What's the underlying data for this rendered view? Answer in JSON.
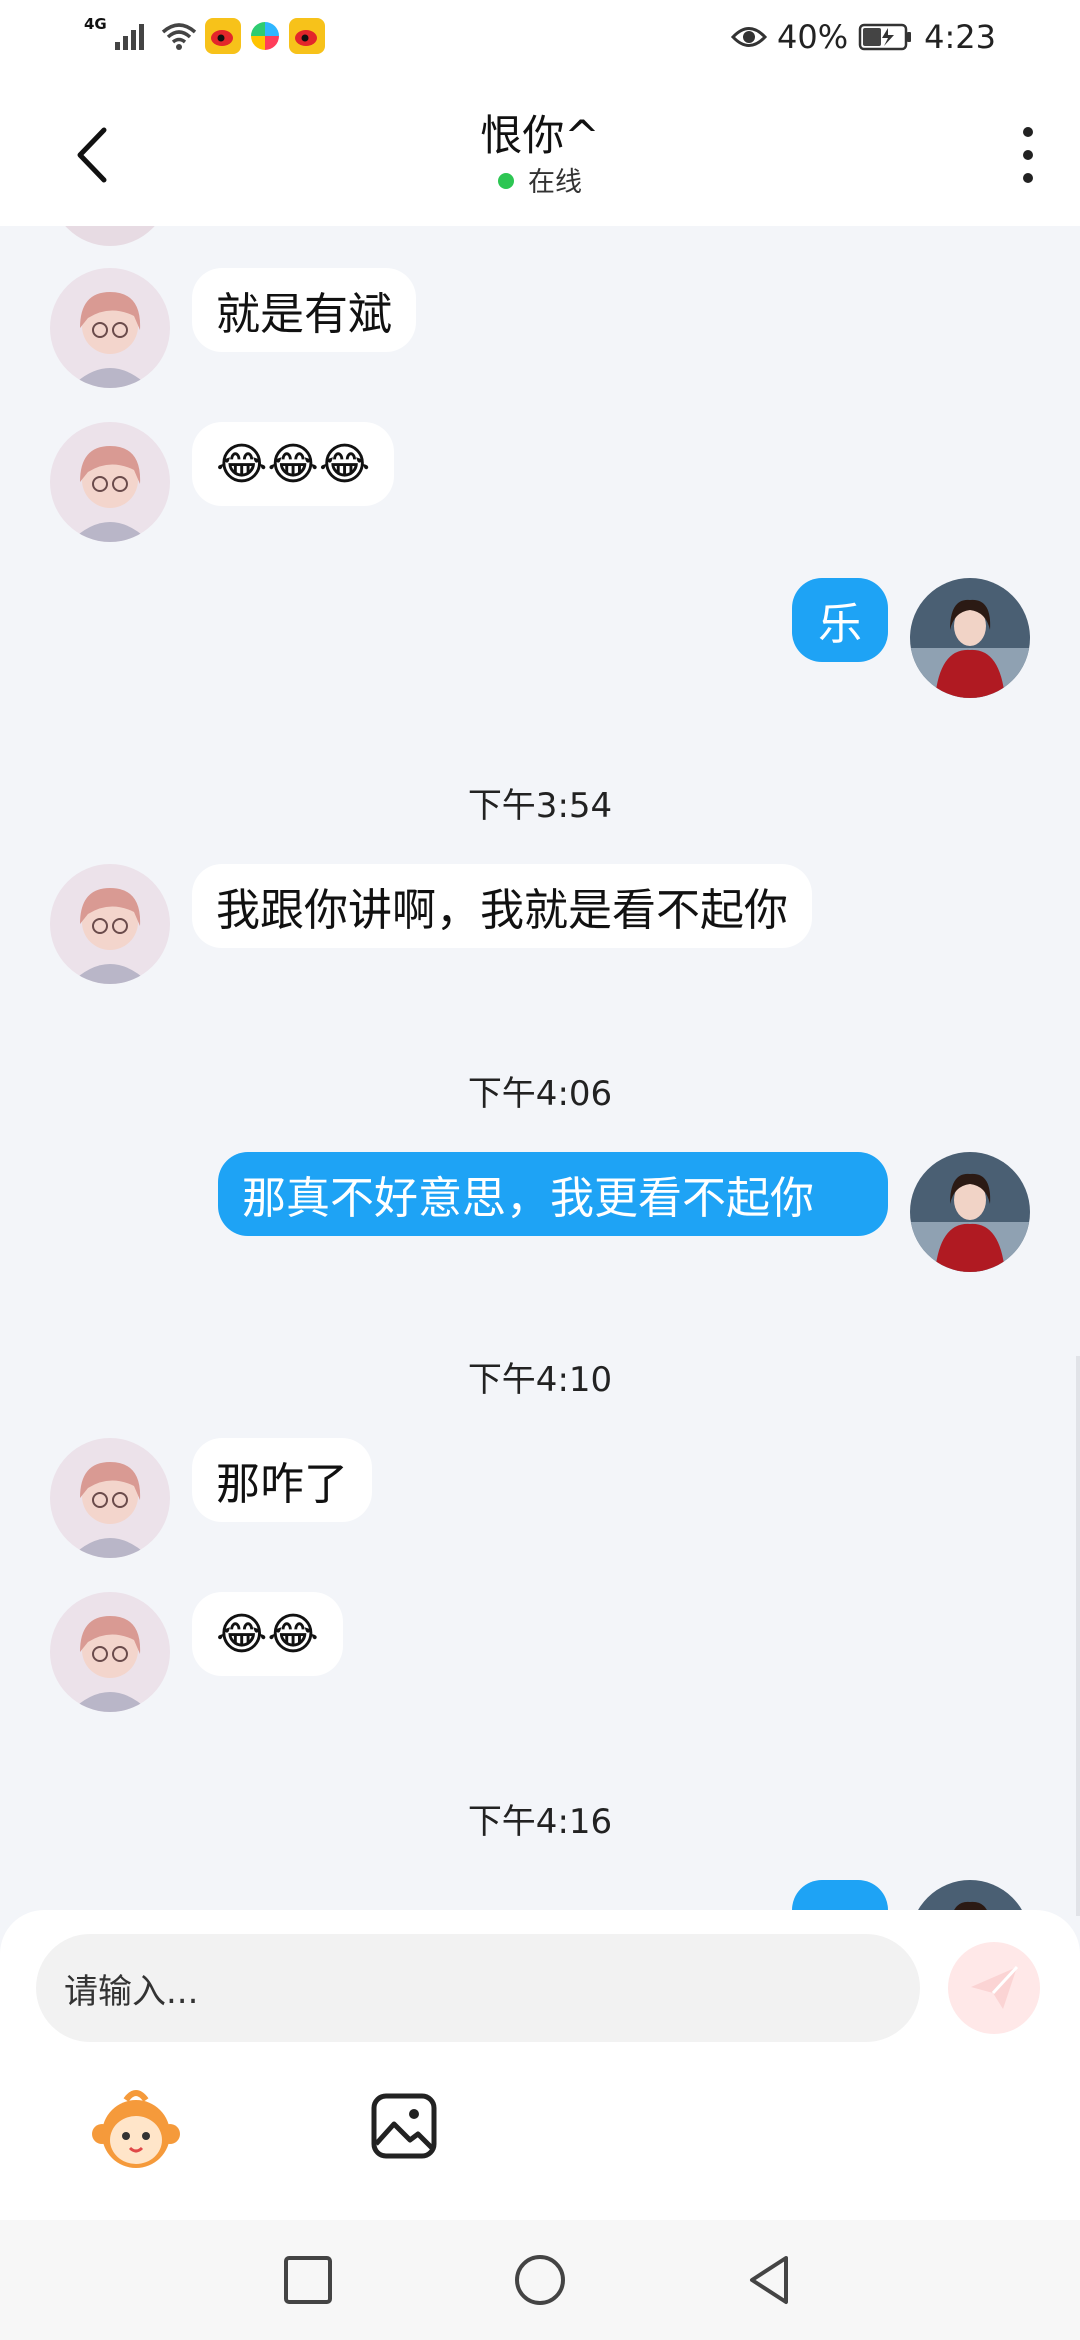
{
  "status_bar": {
    "network": "4G",
    "eye_icon": "eye-icon",
    "battery_percent": "40%",
    "time": "4:23"
  },
  "header": {
    "title": "恨你^",
    "status": "在线"
  },
  "messages": [
    {
      "side": "in",
      "text": "就是有斌"
    },
    {
      "side": "in",
      "text": "😂😂😂"
    },
    {
      "side": "out",
      "text": "乐"
    },
    {
      "type": "time",
      "text": "下午3:54"
    },
    {
      "side": "in",
      "text": "我跟你讲啊，我就是看不起你"
    },
    {
      "type": "time",
      "text": "下午4:06"
    },
    {
      "side": "out",
      "text": "那真不好意思，我更看不起你"
    },
    {
      "type": "time",
      "text": "下午4:10"
    },
    {
      "side": "in",
      "text": "那咋了"
    },
    {
      "side": "in",
      "text": "😂😂"
    },
    {
      "type": "time",
      "text": "下午4:16"
    }
  ],
  "input": {
    "placeholder": "请输入..."
  },
  "colors": {
    "accent": "#1ea3f5",
    "online": "#2dc653",
    "background": "#f3f5f9"
  }
}
